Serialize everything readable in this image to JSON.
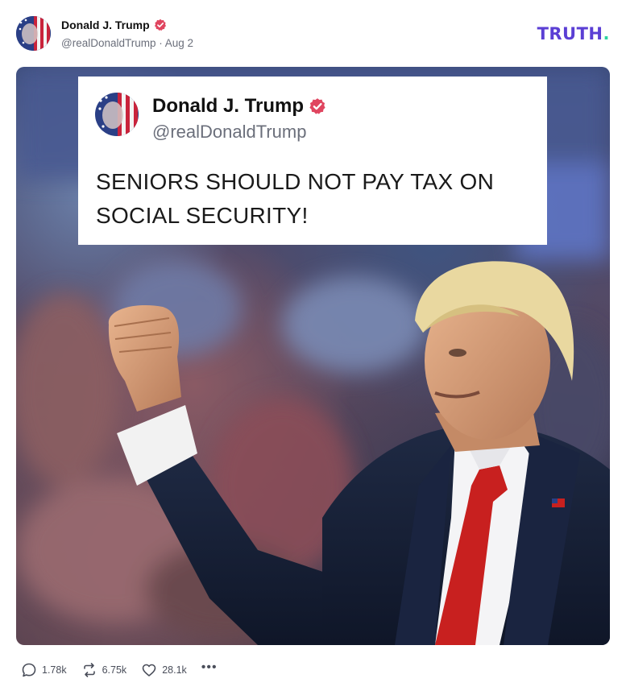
{
  "post": {
    "author_name": "Donald J. Trump",
    "handle": "@realDonaldTrump",
    "separator": "·",
    "date": "Aug 2"
  },
  "brand": {
    "logo_text": "TRUTH",
    "logo_dot": ".",
    "logo_color": "#5b3fd4",
    "logo_dot_color": "#2dd4a0"
  },
  "media": {
    "quote_card": {
      "name": "Donald J. Trump",
      "handle": "@realDonaldTrump",
      "text": "SENIORS SHOULD NOT PAY TAX ON SOCIAL SECURITY!"
    }
  },
  "actions": {
    "replies": "1.78k",
    "reposts": "6.75k",
    "likes": "28.1k",
    "more": "•••"
  },
  "icons": {
    "verified": "verified-badge-icon",
    "reply": "reply-icon",
    "repost": "repost-icon",
    "like": "heart-icon",
    "more": "more-options-icon"
  },
  "colors": {
    "verified_badge": "#e0455f",
    "tie_red": "#c8201f"
  }
}
